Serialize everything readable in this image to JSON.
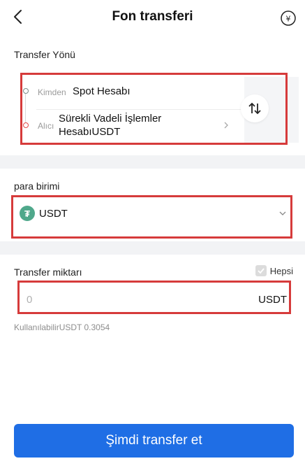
{
  "header": {
    "title": "Fon transferi"
  },
  "direction": {
    "section_label": "Transfer Yönü",
    "from_label": "Kimden",
    "from_account": "Spot Hesabı",
    "to_label": "Alıcı",
    "to_account": "Sürekli Vadeli İşlemler HesabıUSDT"
  },
  "currency": {
    "section_label": "para birimi",
    "selected": "USDT",
    "logo_glyph": "₮"
  },
  "amount": {
    "section_label": "Transfer miktarı",
    "all_label": "Hepsi",
    "placeholder": "0",
    "unit": "USDT",
    "available": "KullanılabilirUSDT 0.3054"
  },
  "submit": {
    "label": "Şimdi transfer et"
  },
  "colors": {
    "primary": "#1f6ee5",
    "usdt": "#4fa88b",
    "highlight": "#d63b3b"
  }
}
